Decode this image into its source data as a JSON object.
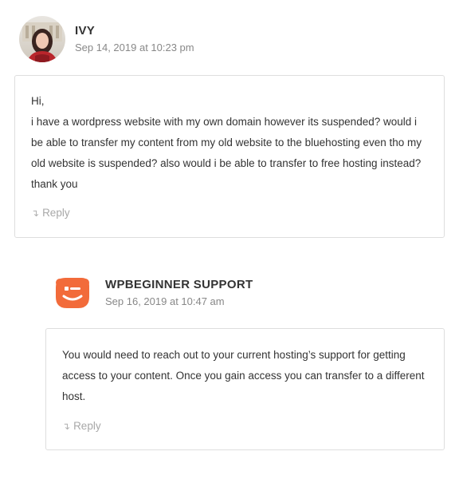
{
  "comments": [
    {
      "author": "IVY",
      "date": "Sep 14, 2019 at 10:23 pm",
      "body": [
        "Hi,",
        "i have a wordpress website with my own domain however its suspended? would i be able to transfer my content from my old website to the bluehosting even tho my old website is suspended? also would i be able to transfer to free hosting instead? thank you"
      ],
      "reply_label": "Reply",
      "avatar_icon": "user-photo-avatar"
    },
    {
      "author": "WPBEGINNER SUPPORT",
      "date": "Sep 16, 2019 at 10:47 am",
      "body": [
        "You would need to reach out to your current hosting’s support for getting access to your content. Once you gain access you can transfer to a different host."
      ],
      "reply_label": "Reply",
      "avatar_icon": "wpbeginner-logo-avatar",
      "avatar_color": "#f26b3a"
    }
  ]
}
